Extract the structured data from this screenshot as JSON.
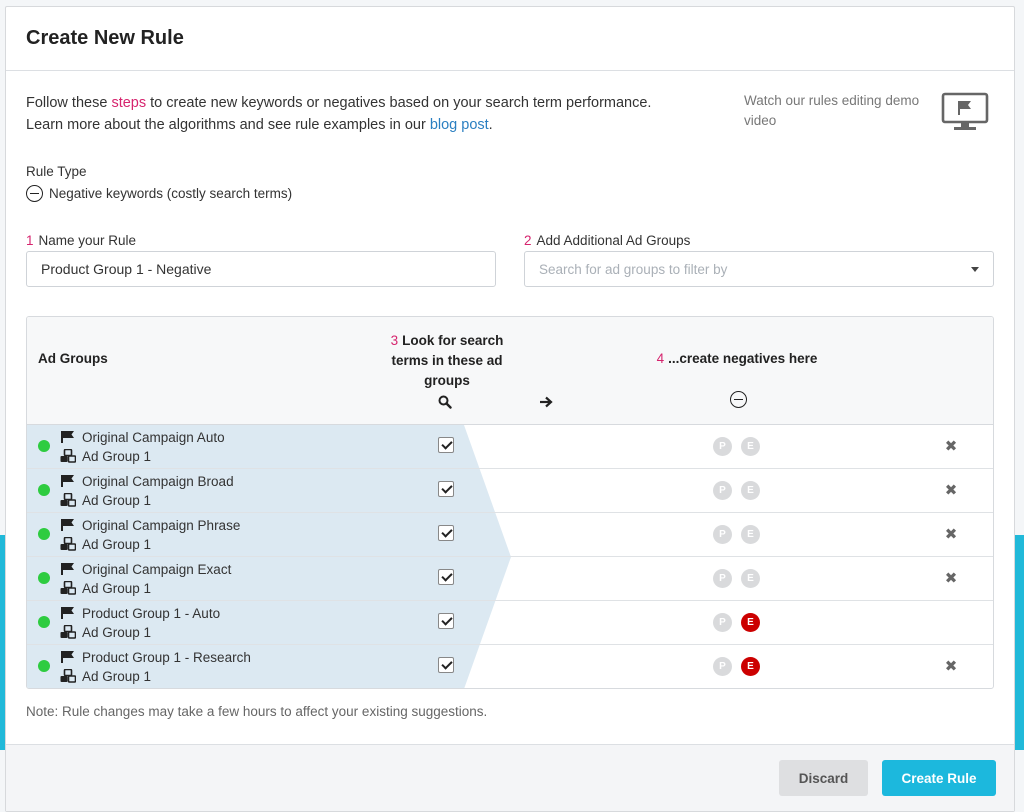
{
  "modal": {
    "title": "Create New Rule"
  },
  "intro": {
    "line1_a": "Follow these ",
    "line1_link": "steps",
    "line1_b": " to create new keywords or negatives based on your search term performance.",
    "line2_a": "Learn more about the algorithms and see rule examples in our ",
    "line2_link": "blog post",
    "line2_b": "."
  },
  "demo": {
    "text": "Watch our rules editing demo video",
    "icon": "monitor-flag-icon"
  },
  "rule_type": {
    "label": "Rule Type",
    "value": "Negative keywords (costly search terms)",
    "icon": "circle-minus-icon"
  },
  "step1": {
    "num": "1",
    "label": "Name your Rule",
    "value": "Product Group 1 - Negative"
  },
  "step2": {
    "num": "2",
    "label": "Add Additional Ad Groups",
    "placeholder": "Search for ad groups to filter by"
  },
  "table": {
    "col_adgroups": "Ad Groups",
    "col_look_num": "3",
    "col_look": "Look for search terms in these ad groups",
    "col_create_num": "4",
    "col_create": "...create negatives here",
    "rows": [
      {
        "campaign": "Original Campaign Auto",
        "adgroup": "Ad Group 1",
        "checked": true,
        "p": "P",
        "e": "E",
        "p_active": false,
        "e_active": false,
        "removable": true
      },
      {
        "campaign": "Original Campaign Broad",
        "adgroup": "Ad Group 1",
        "checked": true,
        "p": "P",
        "e": "E",
        "p_active": false,
        "e_active": false,
        "removable": true
      },
      {
        "campaign": "Original Campaign Phrase",
        "adgroup": "Ad Group 1",
        "checked": true,
        "p": "P",
        "e": "E",
        "p_active": false,
        "e_active": false,
        "removable": true
      },
      {
        "campaign": "Original Campaign Exact",
        "adgroup": "Ad Group 1",
        "checked": true,
        "p": "P",
        "e": "E",
        "p_active": false,
        "e_active": false,
        "removable": true
      },
      {
        "campaign": "Product Group 1 - Auto",
        "adgroup": "Ad Group 1",
        "checked": true,
        "p": "P",
        "e": "E",
        "p_active": false,
        "e_active": true,
        "removable": false
      },
      {
        "campaign": "Product Group 1 - Research",
        "adgroup": "Ad Group 1",
        "checked": true,
        "p": "P",
        "e": "E",
        "p_active": false,
        "e_active": true,
        "removable": true
      }
    ]
  },
  "note": "Note: Rule changes may take a few hours to affect your existing suggestions.",
  "footer": {
    "discard": "Discard",
    "create": "Create Rule"
  },
  "colors": {
    "accent": "#1cb8dd",
    "pink": "#d6246e",
    "link": "#2a7fc1",
    "active_badge": "#cc0000",
    "status_dot": "#2ecc40",
    "band": "#dce9f2"
  }
}
